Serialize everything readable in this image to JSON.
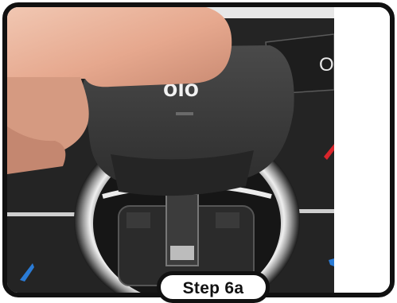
{
  "image": {
    "step_label": "Step 6a",
    "knob_text": "O",
    "knob_text_partial": "oıo",
    "colors": {
      "frame": "#111111",
      "label_bg": "#ffffff",
      "accent_red": "#d9252b",
      "accent_blue": "#2a7bd6",
      "chrome": "#d8d8d8",
      "skin": "#e8b49a"
    }
  }
}
